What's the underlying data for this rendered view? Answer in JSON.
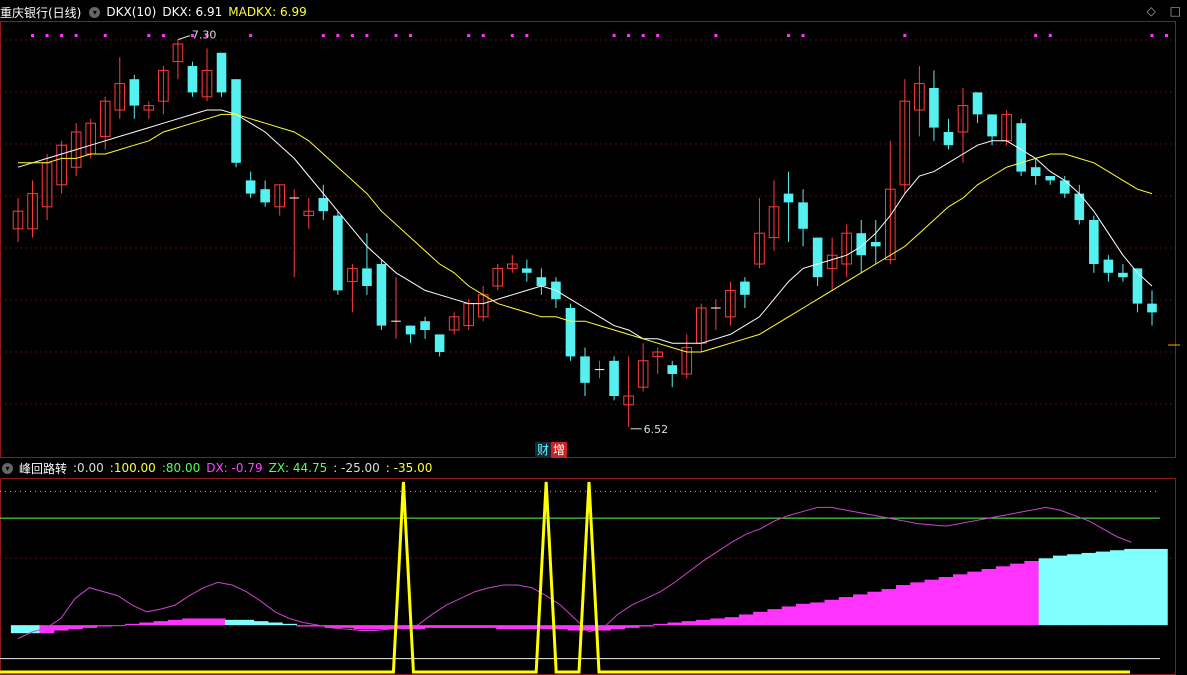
{
  "main_legend": {
    "title": "重庆银行(日线)",
    "indicator": "DKX(10)",
    "dkx_label": "DKX: 6.91",
    "madkx_label": "MADKX: 6.99"
  },
  "sub_legend": {
    "title": "峰回路转",
    "values": [
      ":0.00",
      ":100.00",
      ":80.00",
      "DX: -0.79",
      "ZX: 44.75",
      ": -25.00",
      ": -35.00"
    ]
  },
  "badges": {
    "cai": "财",
    "zeng": "增"
  },
  "corner_icons": [
    "diamond-icon",
    "square-icon"
  ],
  "colors": {
    "up": "#ff3c3c",
    "down": "#55f0f0",
    "dkx": "#ffffff",
    "madkx": "#ffff33",
    "bar_pos": "#ff33ff",
    "bar_neg": "#80ffff",
    "signal": "#ffff00",
    "dx": "#cc44cc",
    "ref": "#55ff55"
  },
  "chart_data": [
    {
      "type": "candlestick",
      "title": "重庆银行(日线)",
      "ylim": [
        6.4,
        7.35
      ],
      "annotations": [
        {
          "text": "7.30",
          "candle_index": 11
        },
        {
          "text": "6.52",
          "candle_index": 42
        }
      ],
      "candles": [
        [
          6.88,
          6.92,
          6.85,
          6.95
        ],
        [
          6.88,
          6.96,
          6.86,
          6.99
        ],
        [
          6.93,
          7.03,
          6.9,
          7.05
        ],
        [
          6.98,
          7.07,
          6.96,
          7.08
        ],
        [
          7.02,
          7.1,
          7.0,
          7.12
        ],
        [
          7.05,
          7.12,
          7.04,
          7.13
        ],
        [
          7.09,
          7.17,
          7.06,
          7.18
        ],
        [
          7.15,
          7.21,
          7.13,
          7.27
        ],
        [
          7.22,
          7.16,
          7.13,
          7.23
        ],
        [
          7.15,
          7.16,
          7.13,
          7.17
        ],
        [
          7.17,
          7.24,
          7.14,
          7.25
        ],
        [
          7.26,
          7.3,
          7.22,
          7.31
        ],
        [
          7.25,
          7.19,
          7.18,
          7.26
        ],
        [
          7.18,
          7.24,
          7.17,
          7.29
        ],
        [
          7.28,
          7.19,
          7.18,
          7.28
        ],
        [
          7.22,
          7.03,
          7.02,
          7.22
        ],
        [
          6.99,
          6.96,
          6.95,
          7.01
        ],
        [
          6.97,
          6.94,
          6.93,
          6.99
        ],
        [
          6.93,
          6.98,
          6.91,
          6.98
        ],
        [
          6.95,
          6.95,
          6.77,
          6.97
        ],
        [
          6.91,
          6.92,
          6.88,
          6.95
        ],
        [
          6.95,
          6.92,
          6.9,
          6.98
        ],
        [
          6.91,
          6.74,
          6.73,
          6.92
        ],
        [
          6.76,
          6.79,
          6.69,
          6.8
        ],
        [
          6.79,
          6.75,
          6.73,
          6.87
        ],
        [
          6.8,
          6.66,
          6.65,
          6.81
        ],
        [
          6.67,
          6.67,
          6.63,
          6.77
        ],
        [
          6.66,
          6.64,
          6.62,
          6.66
        ],
        [
          6.67,
          6.65,
          6.63,
          6.68
        ],
        [
          6.64,
          6.6,
          6.59,
          6.64
        ],
        [
          6.65,
          6.68,
          6.64,
          6.69
        ],
        [
          6.66,
          6.71,
          6.65,
          6.72
        ],
        [
          6.68,
          6.73,
          6.67,
          6.75
        ],
        [
          6.75,
          6.79,
          6.74,
          6.8
        ],
        [
          6.79,
          6.8,
          6.78,
          6.82
        ],
        [
          6.79,
          6.78,
          6.76,
          6.81
        ],
        [
          6.77,
          6.75,
          6.73,
          6.79
        ],
        [
          6.76,
          6.72,
          6.7,
          6.77
        ],
        [
          6.7,
          6.59,
          6.58,
          6.71
        ],
        [
          6.59,
          6.53,
          6.5,
          6.61
        ],
        [
          6.56,
          6.56,
          6.54,
          6.58
        ],
        [
          6.58,
          6.5,
          6.49,
          6.59
        ],
        [
          6.48,
          6.5,
          6.43,
          6.59
        ],
        [
          6.52,
          6.58,
          6.51,
          6.62
        ],
        [
          6.59,
          6.6,
          6.55,
          6.61
        ],
        [
          6.57,
          6.55,
          6.52,
          6.58
        ],
        [
          6.55,
          6.61,
          6.54,
          6.64
        ],
        [
          6.62,
          6.7,
          6.6,
          6.71
        ],
        [
          6.7,
          6.7,
          6.65,
          6.72
        ],
        [
          6.68,
          6.74,
          6.66,
          6.76
        ],
        [
          6.76,
          6.73,
          6.7,
          6.77
        ],
        [
          6.8,
          6.87,
          6.79,
          6.95
        ],
        [
          6.86,
          6.93,
          6.83,
          6.99
        ],
        [
          6.96,
          6.94,
          6.85,
          7.01
        ],
        [
          6.94,
          6.88,
          6.84,
          6.97
        ],
        [
          6.86,
          6.77,
          6.75,
          6.86
        ],
        [
          6.79,
          6.82,
          6.74,
          6.86
        ],
        [
          6.8,
          6.87,
          6.77,
          6.89
        ],
        [
          6.87,
          6.82,
          6.78,
          6.9
        ],
        [
          6.85,
          6.84,
          6.8,
          6.9
        ],
        [
          6.81,
          6.97,
          6.8,
          7.08
        ],
        [
          6.98,
          7.17,
          6.96,
          7.22
        ],
        [
          7.15,
          7.21,
          7.09,
          7.25
        ],
        [
          7.2,
          7.11,
          7.08,
          7.24
        ],
        [
          7.1,
          7.07,
          7.06,
          7.13
        ],
        [
          7.1,
          7.16,
          7.03,
          7.2
        ],
        [
          7.19,
          7.14,
          7.12,
          7.19
        ],
        [
          7.14,
          7.09,
          7.07,
          7.14
        ],
        [
          7.08,
          7.14,
          7.07,
          7.15
        ],
        [
          7.12,
          7.01,
          7.0,
          7.13
        ],
        [
          7.02,
          7.0,
          6.98,
          7.04
        ],
        [
          7.0,
          6.99,
          6.98,
          7.0
        ],
        [
          6.99,
          6.96,
          6.95,
          7.0
        ],
        [
          6.96,
          6.9,
          6.89,
          6.98
        ],
        [
          6.9,
          6.8,
          6.78,
          6.91
        ],
        [
          6.81,
          6.78,
          6.76,
          6.82
        ],
        [
          6.78,
          6.77,
          6.76,
          6.8
        ],
        [
          6.79,
          6.71,
          6.69,
          6.79
        ],
        [
          6.71,
          6.69,
          6.66,
          6.74
        ]
      ],
      "series": [
        {
          "name": "DKX",
          "values": [
            7.02,
            7.03,
            7.04,
            7.05,
            7.06,
            7.07,
            7.08,
            7.09,
            7.1,
            7.11,
            7.12,
            7.13,
            7.14,
            7.15,
            7.15,
            7.14,
            7.12,
            7.1,
            7.07,
            7.04,
            7.0,
            6.96,
            6.92,
            6.88,
            6.84,
            6.81,
            6.78,
            6.76,
            6.74,
            6.73,
            6.72,
            6.71,
            6.71,
            6.72,
            6.73,
            6.74,
            6.75,
            6.74,
            6.72,
            6.7,
            6.68,
            6.66,
            6.65,
            6.63,
            6.63,
            6.62,
            6.62,
            6.62,
            6.63,
            6.64,
            6.66,
            6.68,
            6.72,
            6.76,
            6.79,
            6.8,
            6.81,
            6.82,
            6.84,
            6.87,
            6.91,
            6.96,
            7.0,
            7.01,
            7.03,
            7.05,
            7.07,
            7.08,
            7.08,
            7.06,
            7.04,
            7.01,
            6.99,
            6.96,
            6.92,
            6.87,
            6.82,
            6.78,
            6.75
          ]
        },
        {
          "name": "MADKX",
          "values": [
            7.03,
            7.03,
            7.03,
            7.04,
            7.04,
            7.05,
            7.05,
            7.06,
            7.07,
            7.08,
            7.1,
            7.11,
            7.12,
            7.13,
            7.14,
            7.14,
            7.13,
            7.12,
            7.11,
            7.1,
            7.08,
            7.05,
            7.02,
            6.99,
            6.96,
            6.92,
            6.89,
            6.86,
            6.83,
            6.8,
            6.78,
            6.75,
            6.73,
            6.71,
            6.7,
            6.69,
            6.68,
            6.68,
            6.67,
            6.67,
            6.66,
            6.65,
            6.64,
            6.63,
            6.62,
            6.61,
            6.6,
            6.6,
            6.61,
            6.62,
            6.63,
            6.64,
            6.66,
            6.68,
            6.7,
            6.72,
            6.74,
            6.76,
            6.78,
            6.8,
            6.82,
            6.84,
            6.87,
            6.9,
            6.93,
            6.95,
            6.98,
            7.0,
            7.02,
            7.03,
            7.04,
            7.05,
            7.05,
            7.04,
            7.03,
            7.01,
            6.99,
            6.97,
            6.96
          ]
        }
      ],
      "signal_markers": [
        1,
        2,
        3,
        4,
        6,
        9,
        10,
        12,
        13,
        16,
        21,
        22,
        23,
        24,
        26,
        27,
        31,
        32,
        34,
        35,
        41,
        42,
        43,
        44,
        48,
        53,
        54,
        61,
        70,
        71,
        78,
        79
      ]
    },
    {
      "type": "bar",
      "title": "峰回路转",
      "ylim": [
        -35,
        110
      ],
      "reference_lines": [
        0,
        100,
        80,
        -25,
        -35
      ],
      "bars": [
        -6,
        -6,
        -6,
        -4,
        -3,
        -2,
        -1,
        0,
        1,
        2,
        3,
        4,
        5,
        5,
        5,
        4,
        4,
        3,
        2,
        1,
        -1,
        -1,
        -2,
        -2,
        -3,
        -3,
        -3,
        -3,
        -3,
        -2,
        -2,
        -2,
        -2,
        -2,
        -3,
        -3,
        -3,
        -3,
        -3,
        -4,
        -4,
        -4,
        -3,
        -2,
        -1,
        1,
        2,
        3,
        4,
        5,
        6,
        8,
        10,
        12,
        14,
        16,
        17,
        19,
        21,
        23,
        25,
        27,
        30,
        32,
        34,
        36,
        38,
        40,
        42,
        44,
        46,
        48,
        50,
        52,
        53,
        54,
        55,
        56,
        57,
        57,
        57
      ],
      "series": [
        {
          "name": "DX",
          "values": [
            -10,
            -5,
            -2,
            5,
            20,
            28,
            25,
            22,
            15,
            10,
            12,
            15,
            22,
            28,
            32,
            30,
            25,
            18,
            10,
            5,
            2,
            0,
            -2,
            -3,
            -4,
            -4,
            -3,
            -2,
            0,
            8,
            15,
            20,
            25,
            28,
            30,
            30,
            28,
            22,
            15,
            5,
            -5,
            -2,
            8,
            15,
            20,
            25,
            32,
            40,
            48,
            55,
            62,
            68,
            72,
            78,
            82,
            85,
            88,
            88,
            86,
            84,
            82,
            80,
            78,
            76,
            75,
            74,
            76,
            78,
            80,
            82,
            84,
            86,
            88,
            86,
            82,
            78,
            72,
            66,
            62
          ]
        },
        {
          "name": "ZX",
          "values": [
            -22,
            -22,
            -22,
            -22,
            -22,
            -22,
            -22,
            -22,
            -22,
            -22,
            -22,
            -22,
            -22,
            -22,
            -22,
            -22,
            -22,
            -22,
            -22,
            -22,
            -22,
            -22,
            -22,
            -22,
            -22,
            -22,
            -22,
            -22,
            -22,
            -22,
            -22,
            -22,
            -22,
            -22,
            -22,
            -22,
            -22,
            -22,
            -22,
            -22,
            -22,
            -22,
            -22,
            -22,
            -22,
            -22,
            -22,
            -22,
            -22,
            -22,
            -22,
            -22,
            -22,
            -22,
            -22,
            -22,
            -22,
            -22,
            -22,
            -22,
            -22,
            -22,
            -22,
            -22,
            -22,
            -22,
            -22,
            -22,
            -22,
            -22,
            -22,
            -22,
            -22,
            -22,
            -22,
            -22,
            -22,
            -22,
            -22
          ]
        }
      ],
      "spikes": [
        27,
        37,
        40
      ]
    }
  ]
}
